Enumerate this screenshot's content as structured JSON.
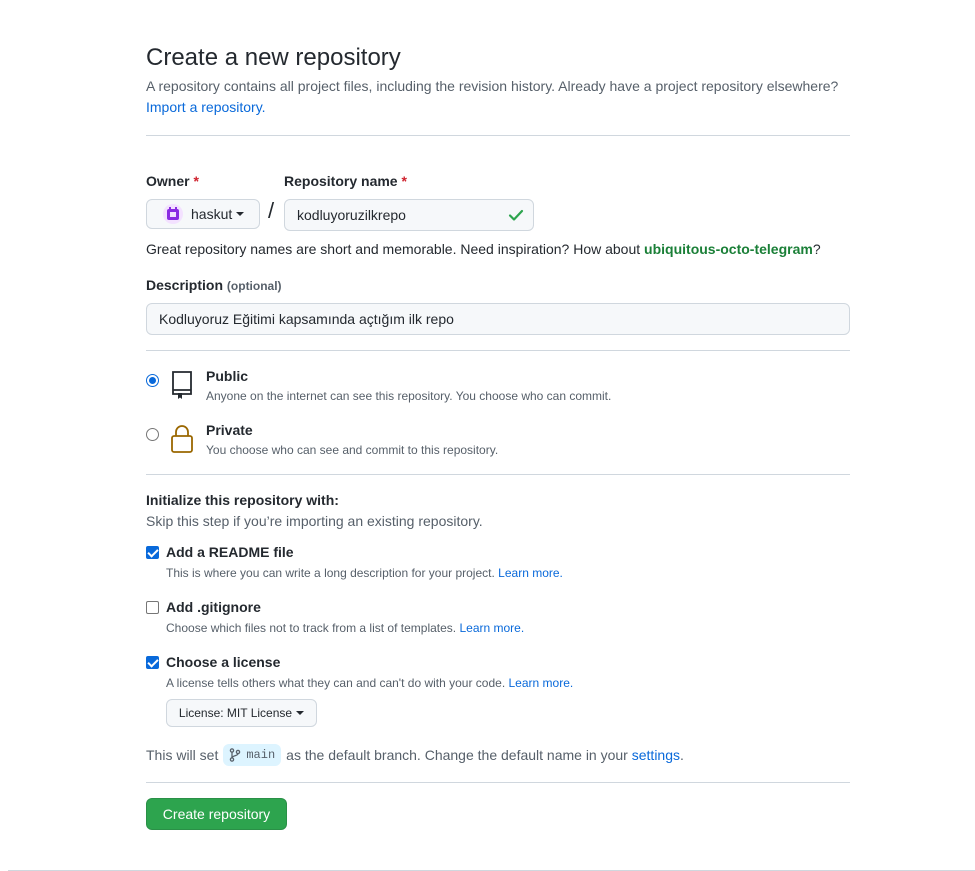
{
  "page": {
    "title": "Create a new repository",
    "description": "A repository contains all project files, including the revision history. Already have a project repository elsewhere?",
    "import_link": "Import a repository."
  },
  "owner": {
    "label": "Owner",
    "required_mark": "*",
    "value": "haskut"
  },
  "repo_name": {
    "label": "Repository name",
    "required_mark": "*",
    "value": "kodluyoruzilkrepo",
    "valid_color": "#2da44e"
  },
  "separator": "/",
  "name_hint": {
    "prefix": "Great repository names are short and memorable. Need inspiration? How about",
    "suggestion": "ubiquitous-octo-telegram",
    "suffix": "?"
  },
  "description": {
    "label": "Description",
    "optional": "(optional)",
    "value": "Kodluyoruz Eğitimi kapsamında açtığım ilk repo"
  },
  "visibility": {
    "public": {
      "title": "Public",
      "note": "Anyone on the internet can see this repository. You choose who can commit.",
      "selected": true
    },
    "private": {
      "title": "Private",
      "note": "You choose who can see and commit to this repository.",
      "selected": false
    }
  },
  "initialize": {
    "title": "Initialize this repository with:",
    "subtitle": "Skip this step if you’re importing an existing repository.",
    "readme": {
      "title": "Add a README file",
      "note": "This is where you can write a long description for your project.",
      "link": "Learn more.",
      "checked": true
    },
    "gitignore": {
      "title": "Add .gitignore",
      "note": "Choose which files not to track from a list of templates.",
      "link": "Learn more.",
      "checked": false
    },
    "license": {
      "title": "Choose a license",
      "note": "A license tells others what they can and can't do with your code.",
      "link": "Learn more.",
      "checked": true,
      "button_label": "License: MIT License"
    }
  },
  "branch": {
    "prefix": "This will set",
    "name": "main",
    "middle": "as the default branch. Change the default name in your",
    "settings_link": "settings",
    "suffix": "."
  },
  "submit": {
    "label": "Create repository",
    "color": "#2da44e"
  },
  "colors": {
    "accent": "#0969da",
    "public_icon": "#24292f",
    "private_icon": "#9a6700"
  }
}
